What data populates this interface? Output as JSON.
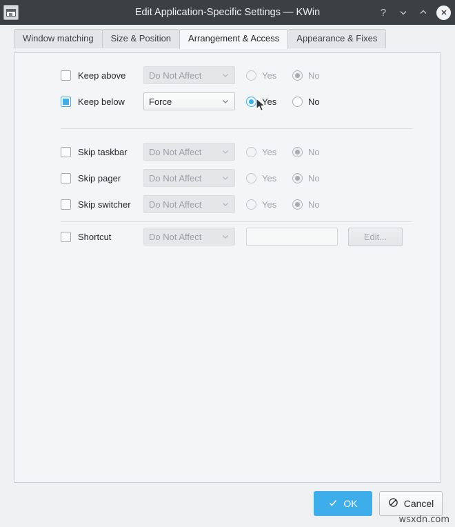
{
  "window": {
    "title": "Edit Application-Specific Settings — KWin",
    "app_icon": "window-settings-icon",
    "controls": {
      "help": "?",
      "minimize": "chevron-down-icon",
      "maximize": "chevron-up-icon",
      "close": "close-icon"
    }
  },
  "tabs": [
    {
      "label": "Window matching",
      "selected": false
    },
    {
      "label": "Size & Position",
      "selected": false
    },
    {
      "label": "Arrangement & Access",
      "selected": true
    },
    {
      "label": "Appearance & Fixes",
      "selected": false
    }
  ],
  "settings": {
    "rows": [
      {
        "label": "Keep above",
        "checked": false,
        "enabled": false,
        "combo_value": "Do Not Affect",
        "yes_label": "Yes",
        "no_label": "No",
        "selected": "No"
      },
      {
        "label": "Keep below",
        "checked": true,
        "enabled": true,
        "combo_value": "Force",
        "yes_label": "Yes",
        "no_label": "No",
        "selected": "Yes"
      },
      {
        "label": "Skip taskbar",
        "checked": false,
        "enabled": false,
        "combo_value": "Do Not Affect",
        "yes_label": "Yes",
        "no_label": "No",
        "selected": "No"
      },
      {
        "label": "Skip pager",
        "checked": false,
        "enabled": false,
        "combo_value": "Do Not Affect",
        "yes_label": "Yes",
        "no_label": "No",
        "selected": "No"
      },
      {
        "label": "Skip switcher",
        "checked": false,
        "enabled": false,
        "combo_value": "Do Not Affect",
        "yes_label": "Yes",
        "no_label": "No",
        "selected": "No"
      }
    ],
    "shortcut": {
      "label": "Shortcut",
      "checked": false,
      "enabled": false,
      "combo_value": "Do Not Affect",
      "field_value": "",
      "edit_label": "Edit..."
    }
  },
  "footer": {
    "ok_label": "OK",
    "cancel_label": "Cancel"
  },
  "watermark": "wsxdn.com",
  "colors": {
    "accent": "#3daee9",
    "titlebar": "#3b4045",
    "panel": "#f4f5f6",
    "background": "#eff0f1"
  }
}
